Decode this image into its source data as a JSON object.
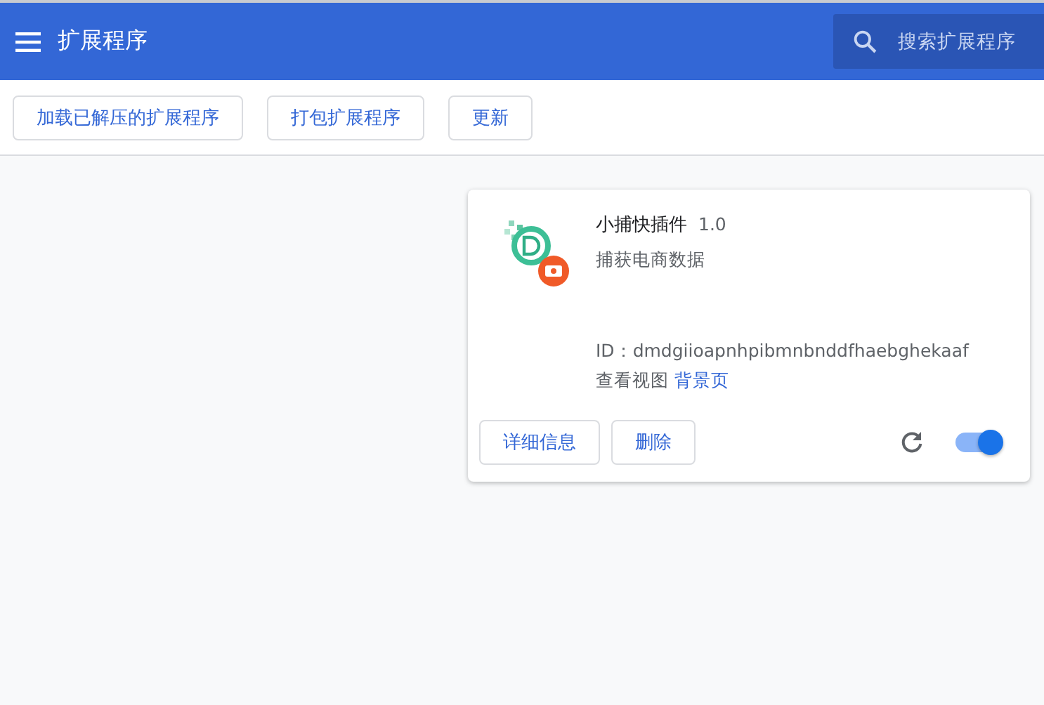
{
  "header": {
    "title": "扩展程序",
    "search": {
      "placeholder": "搜索扩展程序"
    }
  },
  "toolbar": {
    "buttons": [
      "加载已解压的扩展程序",
      "打包扩展程序",
      "更新"
    ]
  },
  "extension": {
    "name": "小捕快插件",
    "version": "1.0",
    "description": "捕获电商数据",
    "id_label": "ID：",
    "id": "dmdgiioapnhpibmnbnddfhaebghekaaf",
    "views_label": "查看视图",
    "views_link": "背景页",
    "buttons": [
      "详细信息",
      "删除"
    ],
    "enabled": true
  }
}
